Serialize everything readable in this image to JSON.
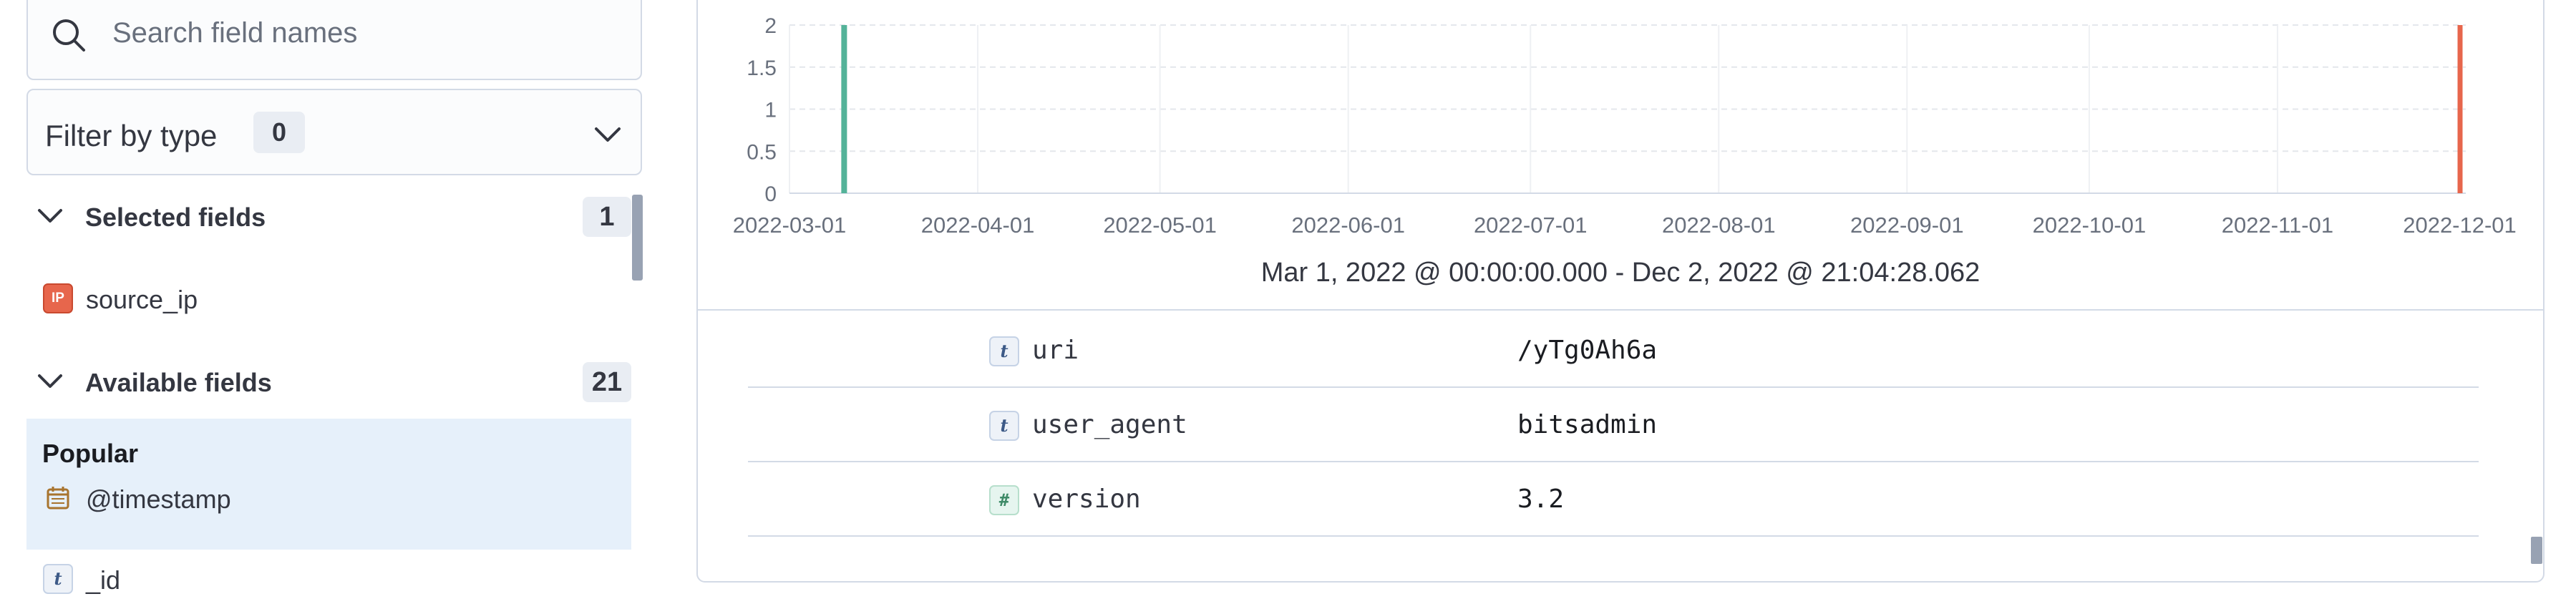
{
  "sidebar": {
    "search": {
      "placeholder": "Search field names"
    },
    "filter": {
      "label": "Filter by type",
      "count": "0"
    },
    "selected": {
      "title": "Selected fields",
      "count": "1",
      "fields": [
        {
          "name": "source_ip",
          "type": "ip"
        }
      ]
    },
    "available": {
      "title": "Available fields",
      "count": "21",
      "popular_title": "Popular",
      "popular_fields": [
        {
          "name": "@timestamp",
          "type": "date"
        }
      ],
      "fields": [
        {
          "name": "_id",
          "type": "string"
        }
      ]
    }
  },
  "chart_data": {
    "type": "bar",
    "title": "",
    "xlabel": "",
    "ylabel": "",
    "x_tick_labels": [
      "2022-03-01",
      "2022-04-01",
      "2022-05-01",
      "2022-06-01",
      "2022-07-01",
      "2022-08-01",
      "2022-09-01",
      "2022-10-01",
      "2022-11-01",
      "2022-12-01"
    ],
    "y_tick_labels": [
      "0",
      "0.5",
      "1",
      "1.5",
      "2"
    ],
    "ylim": [
      0,
      2
    ],
    "xlim": [
      "2022-03-01",
      "2022-12-02"
    ],
    "grid": true,
    "series": [
      {
        "x": [
          "2022-03-10"
        ],
        "values": [
          2
        ],
        "color": "#54b399"
      }
    ],
    "annotations": [
      {
        "type": "vertical-line",
        "x": "2022-12-01",
        "color": "#e7664c"
      }
    ],
    "time_range_label": "Mar 1, 2022 @ 00:00:00.000 - Dec 2, 2022 @ 21:04:28.062"
  },
  "document": {
    "rows": [
      {
        "field": "uri",
        "type": "string",
        "value": "/yTg0Ah6a"
      },
      {
        "field": "user_agent",
        "type": "string",
        "value": "bitsadmin"
      },
      {
        "field": "version",
        "type": "number",
        "value": "3.2"
      }
    ]
  },
  "tokens": {
    "ip": "IP",
    "string": "t",
    "number": "#"
  },
  "colors": {
    "bar": "#54b399",
    "now_marker": "#e7664c",
    "popular_bg": "#e6f0fa"
  }
}
